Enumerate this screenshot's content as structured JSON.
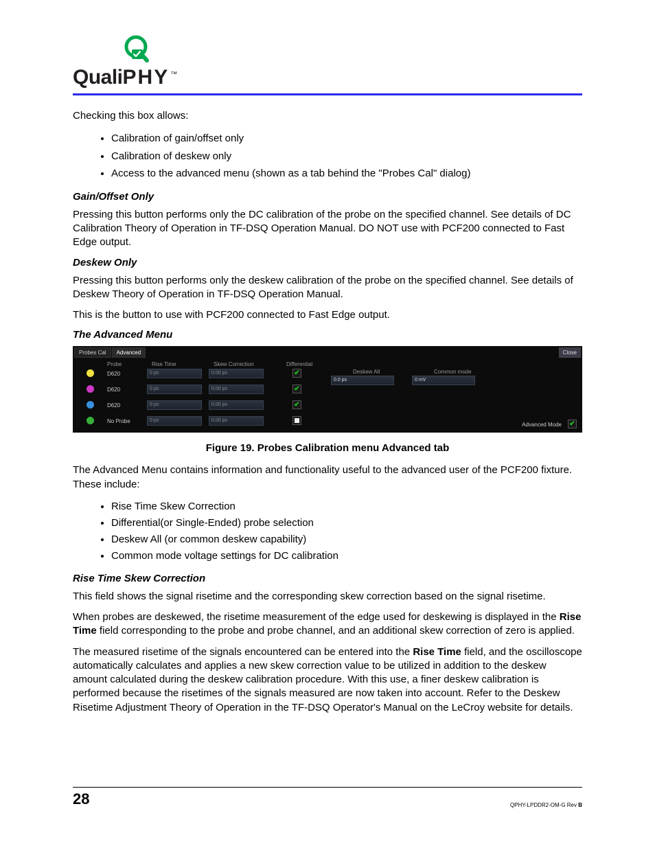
{
  "logo": {
    "brand_left": "Quali",
    "brand_right": "PHY",
    "tm": "™"
  },
  "intro": "Checking this box allows:",
  "intro_bullets": [
    "Calibration of gain/offset only",
    "Calibration of deskew only",
    "Access to the advanced menu (shown as a tab behind the \"Probes Cal\" dialog)"
  ],
  "gain_offset": {
    "heading": "Gain/Offset Only",
    "para": "Pressing this button performs only the DC calibration of the probe on the specified channel. See details of DC Calibration Theory of Operation in TF-DSQ Operation Manual. DO NOT use with PCF200 connected to Fast Edge output."
  },
  "deskew": {
    "heading": "Deskew Only",
    "para1": "Pressing this button performs only the deskew calibration of the probe on the specified channel. See details of Deskew Theory of Operation in TF-DSQ Operation Manual.",
    "para2": "This is the button to use with PCF200 connected to Fast Edge output."
  },
  "advanced_menu": {
    "heading": "The Advanced Menu"
  },
  "figure": {
    "tabs": [
      "Probes Cal",
      "Advanced"
    ],
    "close": "Close",
    "headers": {
      "probe": "Probe",
      "rise_time": "Rise Time",
      "skew_correction": "Skew Correction",
      "differential": "Differential",
      "deskew_all": "Deskew All",
      "common_mode": "Common mode"
    },
    "deskew_all_value": "0.0 ps",
    "common_mode_value": "0 mV",
    "adv_mode_label": "Advanced Mode",
    "rows": [
      {
        "color": "#f0e040",
        "probe": "D620",
        "rise": "0 ps",
        "skew": "0.00 ps",
        "diff": true
      },
      {
        "color": "#d038c8",
        "probe": "D620",
        "rise": "0 ps",
        "skew": "0.00 ps",
        "diff": true
      },
      {
        "color": "#3890e0",
        "probe": "D620",
        "rise": "0 ps",
        "skew": "0.00 ps",
        "diff": true
      },
      {
        "color": "#38b038",
        "probe": "No Probe",
        "rise": "0 ps",
        "skew": "0.00 ps",
        "diff": false
      }
    ]
  },
  "figure_caption": "Figure 19. Probes Calibration menu Advanced tab",
  "advanced_para": "The Advanced Menu contains information and functionality useful to the advanced user of the PCF200 fixture. These include:",
  "advanced_bullets": [
    "Rise Time Skew Correction",
    "Differential(or Single-Ended) probe selection",
    "Deskew All (or common deskew capability)",
    "Common mode voltage settings for DC calibration"
  ],
  "risetime": {
    "heading": "Rise Time Skew Correction",
    "p1": "This field shows the signal risetime and the corresponding skew correction based on the signal risetime.",
    "p2_pre": "When probes are deskewed, the risetime measurement of the edge used for deskewing is displayed in the ",
    "p2_bold": "Rise Time",
    "p2_post": " field corresponding to the probe and probe channel, and an additional skew correction of zero is applied.",
    "p3_pre": "The measured risetime of the signals encountered can be entered into the ",
    "p3_bold": "Rise Time",
    "p3_post": " field, and the oscilloscope automatically calculates and applies a new skew correction value to be utilized in addition to the deskew amount calculated during the deskew calibration procedure. With this use, a finer deskew calibration is performed because the risetimes of the signals measured are now taken into account. Refer to the Deskew Risetime Adjustment Theory of Operation in the TF-DSQ Operator's Manual on the LeCroy website for details."
  },
  "footer": {
    "page": "28",
    "doc_id_pre": "QPHY-LPDDR2-OM-G Rev ",
    "doc_id_rev": "B"
  }
}
